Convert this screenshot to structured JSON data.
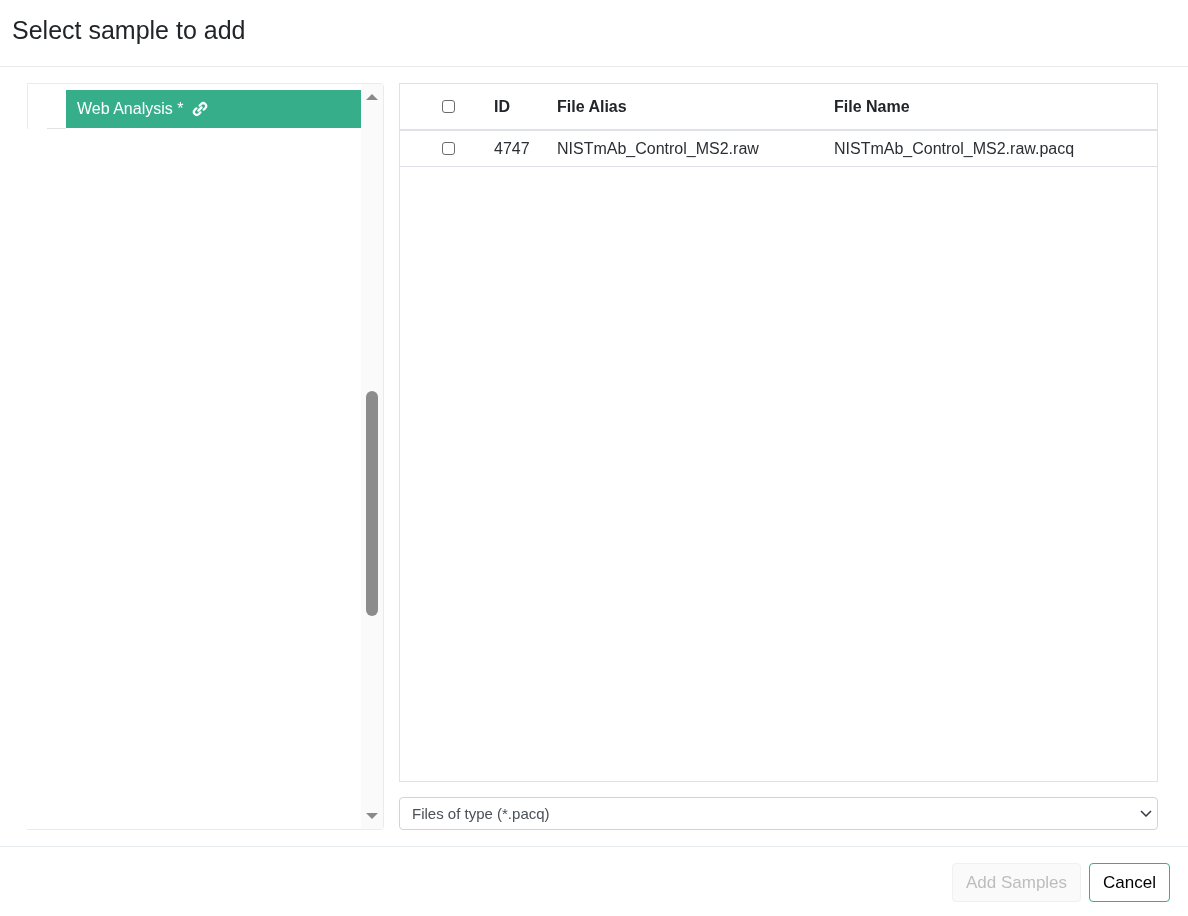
{
  "dialog": {
    "title": "Select sample to add"
  },
  "tree": {
    "items": [
      {
        "label": "Web Analysis *",
        "selected": true
      }
    ]
  },
  "table": {
    "select_all": {
      "checked": false
    },
    "columns": [
      "ID",
      "File Alias",
      "File Name"
    ],
    "rows": [
      {
        "checked": false,
        "cells": [
          "4747",
          "NISTmAb_Control_MS2.raw",
          "NISTmAb_Control_MS2.raw.pacq"
        ]
      }
    ]
  },
  "file_type": {
    "value": "Files of type (*.pacq)"
  },
  "buttons": [
    {
      "label": "Add Samples",
      "disabled": true
    },
    {
      "label": "Cancel",
      "disabled": false
    }
  ]
}
